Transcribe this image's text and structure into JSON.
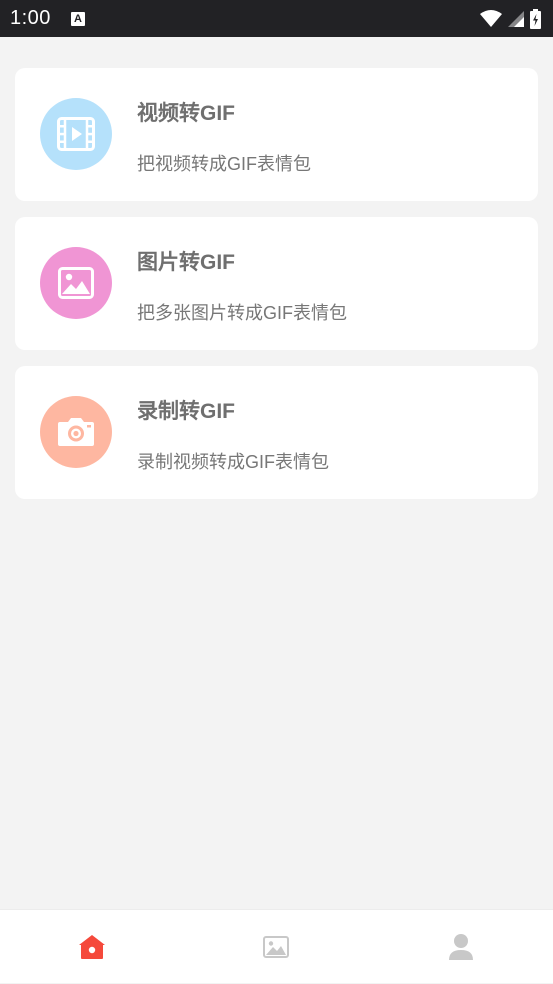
{
  "status_bar": {
    "time": "1:00",
    "notification_icon": "a-letter-icon",
    "icons": [
      "wifi-icon",
      "signal-icon",
      "battery-charging-icon"
    ]
  },
  "cards": [
    {
      "title": "视频转GIF",
      "subtitle": "把视频转成GIF表情包",
      "icon": "film-icon",
      "icon_bg": "#b5e1fb"
    },
    {
      "title": "图片转GIF",
      "subtitle": "把多张图片转成GIF表情包",
      "icon": "image-icon",
      "icon_bg": "#f095d4"
    },
    {
      "title": "录制转GIF",
      "subtitle": "录制视频转成GIF表情包",
      "icon": "camera-icon",
      "icon_bg": "#feb7a1"
    }
  ],
  "tab_bar": {
    "tabs": [
      {
        "icon": "home-icon",
        "active": true
      },
      {
        "icon": "gallery-icon",
        "active": false
      },
      {
        "icon": "user-icon",
        "active": false
      }
    ],
    "active_color": "#f5493b",
    "inactive_color": "#c8c8c8"
  }
}
